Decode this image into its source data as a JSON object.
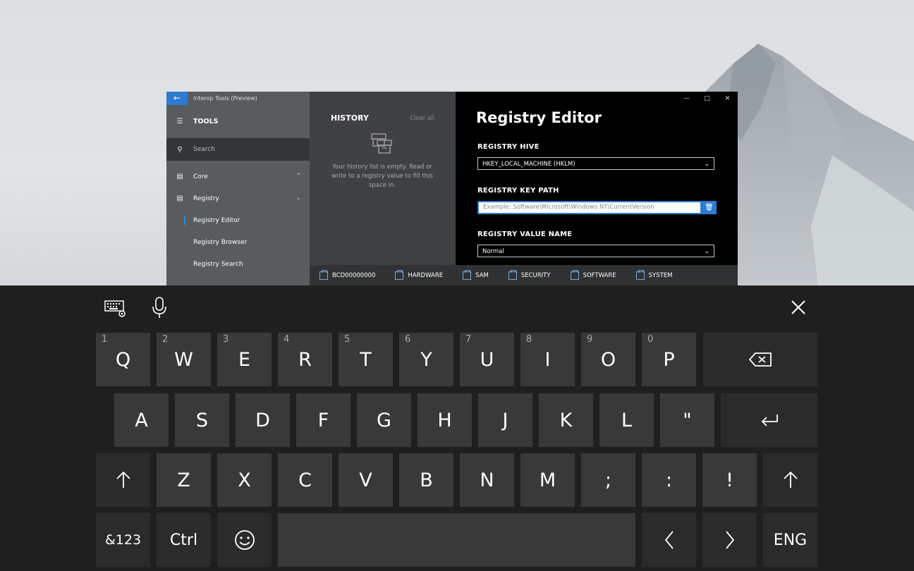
{
  "window": {
    "app_title": "Interop Tools (Preview)",
    "back_icon": "arrow-left-icon"
  },
  "nav": {
    "tools_label": "TOOLS",
    "search_placeholder": "Search",
    "items": [
      {
        "label": "Core",
        "icon": "core-icon",
        "chevron": "chevron-up"
      },
      {
        "label": "Registry",
        "icon": "registry-icon",
        "chevron": "chevron-down"
      }
    ],
    "sub_items": [
      {
        "label": "Registry Editor",
        "selected": true
      },
      {
        "label": "Registry Browser"
      },
      {
        "label": "Registry Search"
      }
    ]
  },
  "history": {
    "title": "HISTORY",
    "clear_label": "Clear all",
    "empty_text": "Your history list is empty. Read or write to a registry value to fill this space in."
  },
  "editor": {
    "title": "Registry Editor",
    "hive_label": "REGISTRY HIVE",
    "hive_value": "HKEY_LOCAL_MACHINE (HKLM)",
    "key_path_label": "REGISTRY KEY PATH",
    "key_path_placeholder": "Example: Software\\Microsoft\\Windows NT\\CurrentVersion",
    "value_name_label": "REGISTRY VALUE NAME",
    "value_name_value": "Normal"
  },
  "hives": [
    "BCD00000000",
    "HARDWARE",
    "SAM",
    "SECURITY",
    "SOFTWARE",
    "SYSTEM"
  ],
  "keyboard": {
    "row1": [
      {
        "k": "Q",
        "n": "1"
      },
      {
        "k": "W",
        "n": "2"
      },
      {
        "k": "E",
        "n": "3"
      },
      {
        "k": "R",
        "n": "4"
      },
      {
        "k": "T",
        "n": "5"
      },
      {
        "k": "Y",
        "n": "6"
      },
      {
        "k": "U",
        "n": "7"
      },
      {
        "k": "I",
        "n": "8"
      },
      {
        "k": "O",
        "n": "9"
      },
      {
        "k": "P",
        "n": "0"
      }
    ],
    "row2": [
      "A",
      "S",
      "D",
      "F",
      "G",
      "H",
      "J",
      "K",
      "L",
      "\""
    ],
    "row3": [
      "Z",
      "X",
      "C",
      "V",
      "B",
      "N",
      "M",
      ";",
      ":",
      "!"
    ],
    "sym_label": "&123",
    "ctrl_label": "Ctrl",
    "lang_label": "ENG",
    "colors": {
      "key": "#393939",
      "fn_key": "#2b2b2b",
      "background": "#1f1f1f",
      "accent": "#2b7bd0"
    }
  }
}
